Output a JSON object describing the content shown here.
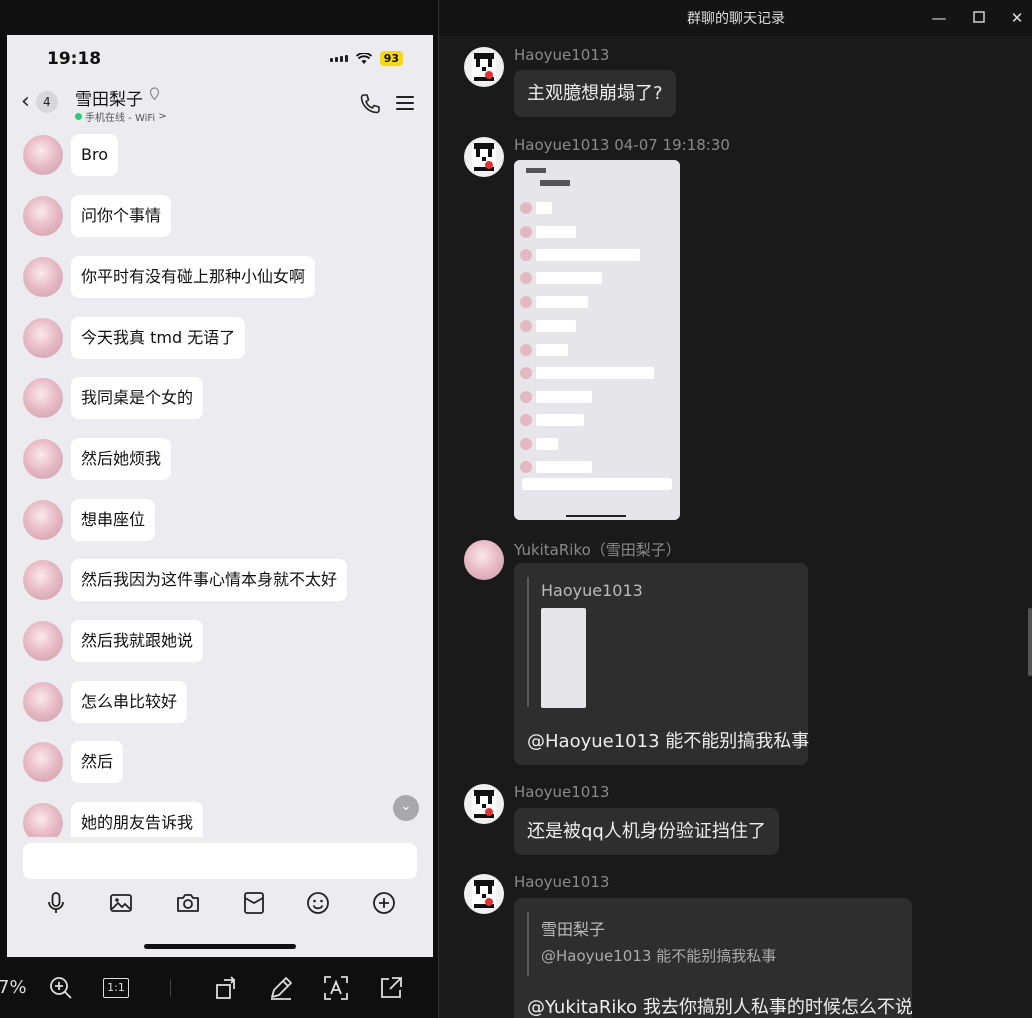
{
  "phone": {
    "status": {
      "time": "19:18",
      "battery": "93"
    },
    "header": {
      "unread": "4",
      "contact_name": "雪田梨子",
      "contact_status": "手机在线 - WiFi",
      "status_chevron": ">"
    },
    "messages": [
      "Bro",
      "问你个事情",
      "你平时有没有碰上那种小仙女啊",
      "今天我真 tmd 无语了",
      "我同桌是个女的",
      "然后她烦我",
      "想串座位",
      "然后我因为这件事心情本身就不太好",
      "然后我就跟她说",
      "怎么串比较好",
      "然后",
      "她的朋友告诉我"
    ],
    "input_placeholder": ""
  },
  "viewer_toolbar": {
    "zoom": "7%",
    "ratio_label": "1:1"
  },
  "history_window": {
    "title": "群聊的聊天记录",
    "entries": [
      {
        "sender": "Haoyue1013",
        "text": "主观臆想崩塌了?"
      },
      {
        "sender": "Haoyue1013 04-07 19:18:30",
        "type": "image"
      },
      {
        "sender": "YukitaRiko（雪田梨子）",
        "quote_name": "Haoyue1013",
        "text": "@Haoyue1013 能不能别搞我私事"
      },
      {
        "sender": "Haoyue1013",
        "text": "还是被qq人机身份验证挡住了"
      },
      {
        "sender": "Haoyue1013",
        "quote_name": "雪田梨子",
        "quote_text": "@Haoyue1013 能不能别搞我私事",
        "text": "@YukitaRiko 我去你搞别人私事的时候怎么不说"
      }
    ]
  },
  "colors": {
    "online": "#2ecc71",
    "battery": "#f5d90a",
    "bubble_dark": "#2e2e2e"
  }
}
